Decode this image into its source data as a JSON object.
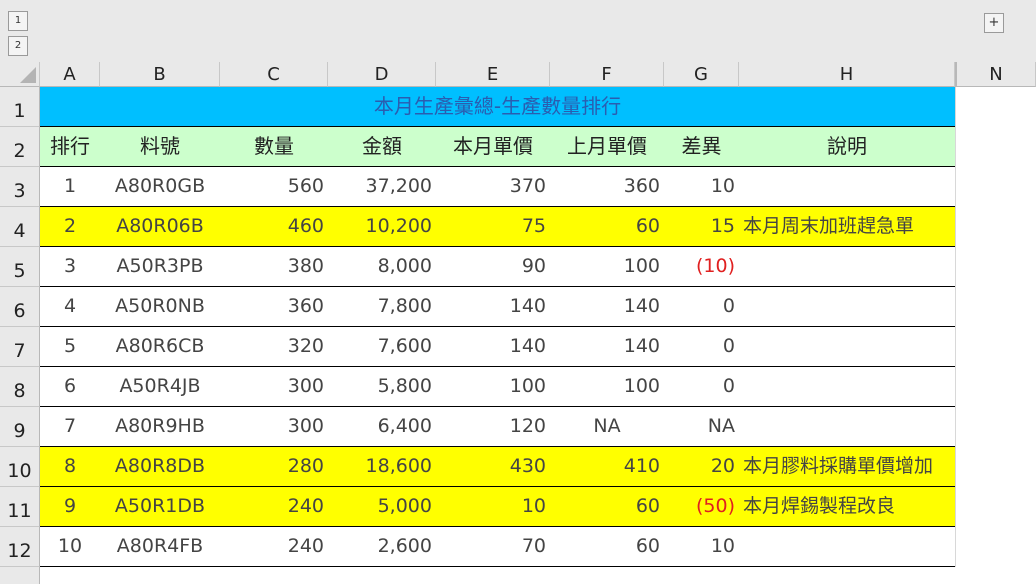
{
  "outline": {
    "level_buttons": [
      "1",
      "2"
    ],
    "expand_symbol": "+"
  },
  "columns": [
    "A",
    "B",
    "C",
    "D",
    "E",
    "F",
    "G",
    "H",
    "N"
  ],
  "row_numbers": [
    "1",
    "2",
    "3",
    "4",
    "5",
    "6",
    "7",
    "8",
    "9",
    "10",
    "11",
    "12"
  ],
  "colors": {
    "title_fill": "#00bfff",
    "header_fill": "#ccffcc",
    "highlight_fill": "#ffff00",
    "title_text": "#2a5db0",
    "negative_text": "#e02020"
  },
  "table": {
    "title": "本月生產彙總-生產數量排行",
    "headers": [
      "排行",
      "料號",
      "數量",
      "金額",
      "本月單價",
      "上月單價",
      "差異",
      "說明"
    ],
    "rows": [
      {
        "rank": "1",
        "part": "A80R0GB",
        "qty": "560",
        "amount": "37,200",
        "this_price": "370",
        "last_price": "360",
        "diff": "10",
        "note": "",
        "highlight": false,
        "negative": false
      },
      {
        "rank": "2",
        "part": "A80R06B",
        "qty": "460",
        "amount": "10,200",
        "this_price": "75",
        "last_price": "60",
        "diff": "15",
        "note": "本月周末加班趕急單",
        "highlight": true,
        "negative": false
      },
      {
        "rank": "3",
        "part": "A50R3PB",
        "qty": "380",
        "amount": "8,000",
        "this_price": "90",
        "last_price": "100",
        "diff": "(10)",
        "note": "",
        "highlight": false,
        "negative": true
      },
      {
        "rank": "4",
        "part": "A50R0NB",
        "qty": "360",
        "amount": "7,800",
        "this_price": "140",
        "last_price": "140",
        "diff": "0",
        "note": "",
        "highlight": false,
        "negative": false
      },
      {
        "rank": "5",
        "part": "A80R6CB",
        "qty": "320",
        "amount": "7,600",
        "this_price": "140",
        "last_price": "140",
        "diff": "0",
        "note": "",
        "highlight": false,
        "negative": false
      },
      {
        "rank": "6",
        "part": "A50R4JB",
        "qty": "300",
        "amount": "5,800",
        "this_price": "100",
        "last_price": "100",
        "diff": "0",
        "note": "",
        "highlight": false,
        "negative": false
      },
      {
        "rank": "7",
        "part": "A80R9HB",
        "qty": "300",
        "amount": "6,400",
        "this_price": "120",
        "last_price": "NA",
        "diff": "NA",
        "note": "",
        "highlight": false,
        "negative": false
      },
      {
        "rank": "8",
        "part": "A80R8DB",
        "qty": "280",
        "amount": "18,600",
        "this_price": "430",
        "last_price": "410",
        "diff": "20",
        "note": "本月膠料採購單價增加",
        "highlight": true,
        "negative": false
      },
      {
        "rank": "9",
        "part": "A50R1DB",
        "qty": "240",
        "amount": "5,000",
        "this_price": "10",
        "last_price": "60",
        "diff": "(50)",
        "note": "本月焊錫製程改良",
        "highlight": true,
        "negative": true
      },
      {
        "rank": "10",
        "part": "A80R4FB",
        "qty": "240",
        "amount": "2,600",
        "this_price": "70",
        "last_price": "60",
        "diff": "10",
        "note": "",
        "highlight": false,
        "negative": false
      }
    ]
  }
}
